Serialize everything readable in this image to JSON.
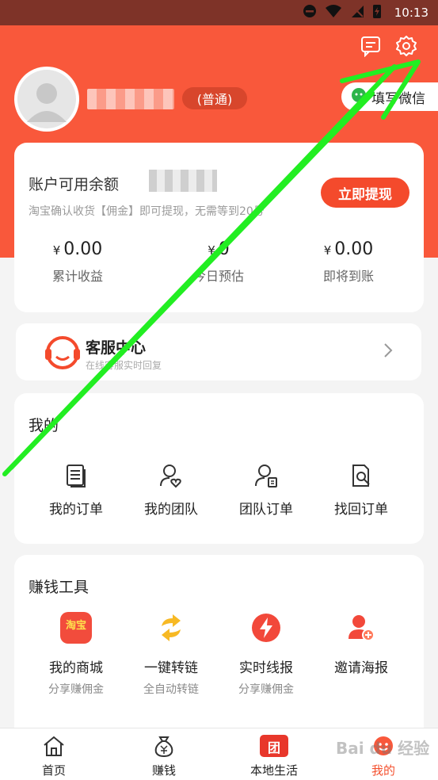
{
  "status_bar": {
    "time": "10:13"
  },
  "header": {
    "level": "(普通)",
    "wechat_button": "填写微信"
  },
  "balance": {
    "title": "账户可用余额",
    "description": "淘宝确认收货【佣金】即可提现，无需等到20号",
    "withdraw_button": "立即提现",
    "currency": "¥",
    "stats": [
      {
        "value": "0.00",
        "label": "累计收益"
      },
      {
        "value": "0",
        "label": "今日预估"
      },
      {
        "value": "0.00",
        "label": "即将到账"
      }
    ]
  },
  "service": {
    "title": "客服中心",
    "subtitle": "在线客服实时回复"
  },
  "mine": {
    "title": "我的",
    "items": [
      {
        "label": "我的订单",
        "icon": "orders-icon"
      },
      {
        "label": "我的团队",
        "icon": "team-icon"
      },
      {
        "label": "团队订单",
        "icon": "team-orders-icon"
      },
      {
        "label": "找回订单",
        "icon": "find-order-icon"
      }
    ]
  },
  "tools": {
    "title": "赚钱工具",
    "items": [
      {
        "label": "我的商城",
        "sub": "分享赚佣金",
        "icon_text": "淘宝"
      },
      {
        "label": "一键转链",
        "sub": "全自动转链"
      },
      {
        "label": "实时线报",
        "sub": "分享赚佣金"
      },
      {
        "label": "邀请海报",
        "sub": ""
      }
    ]
  },
  "tabs": [
    {
      "label": "首页"
    },
    {
      "label": "赚钱"
    },
    {
      "label": "本地生活",
      "icon_text": "团"
    },
    {
      "label": "我的",
      "active": true
    }
  ],
  "watermark": "Bai du 经验",
  "colors": {
    "brand": "#f9583b",
    "accent": "#f44a2c",
    "arrow": "#22ee22"
  }
}
